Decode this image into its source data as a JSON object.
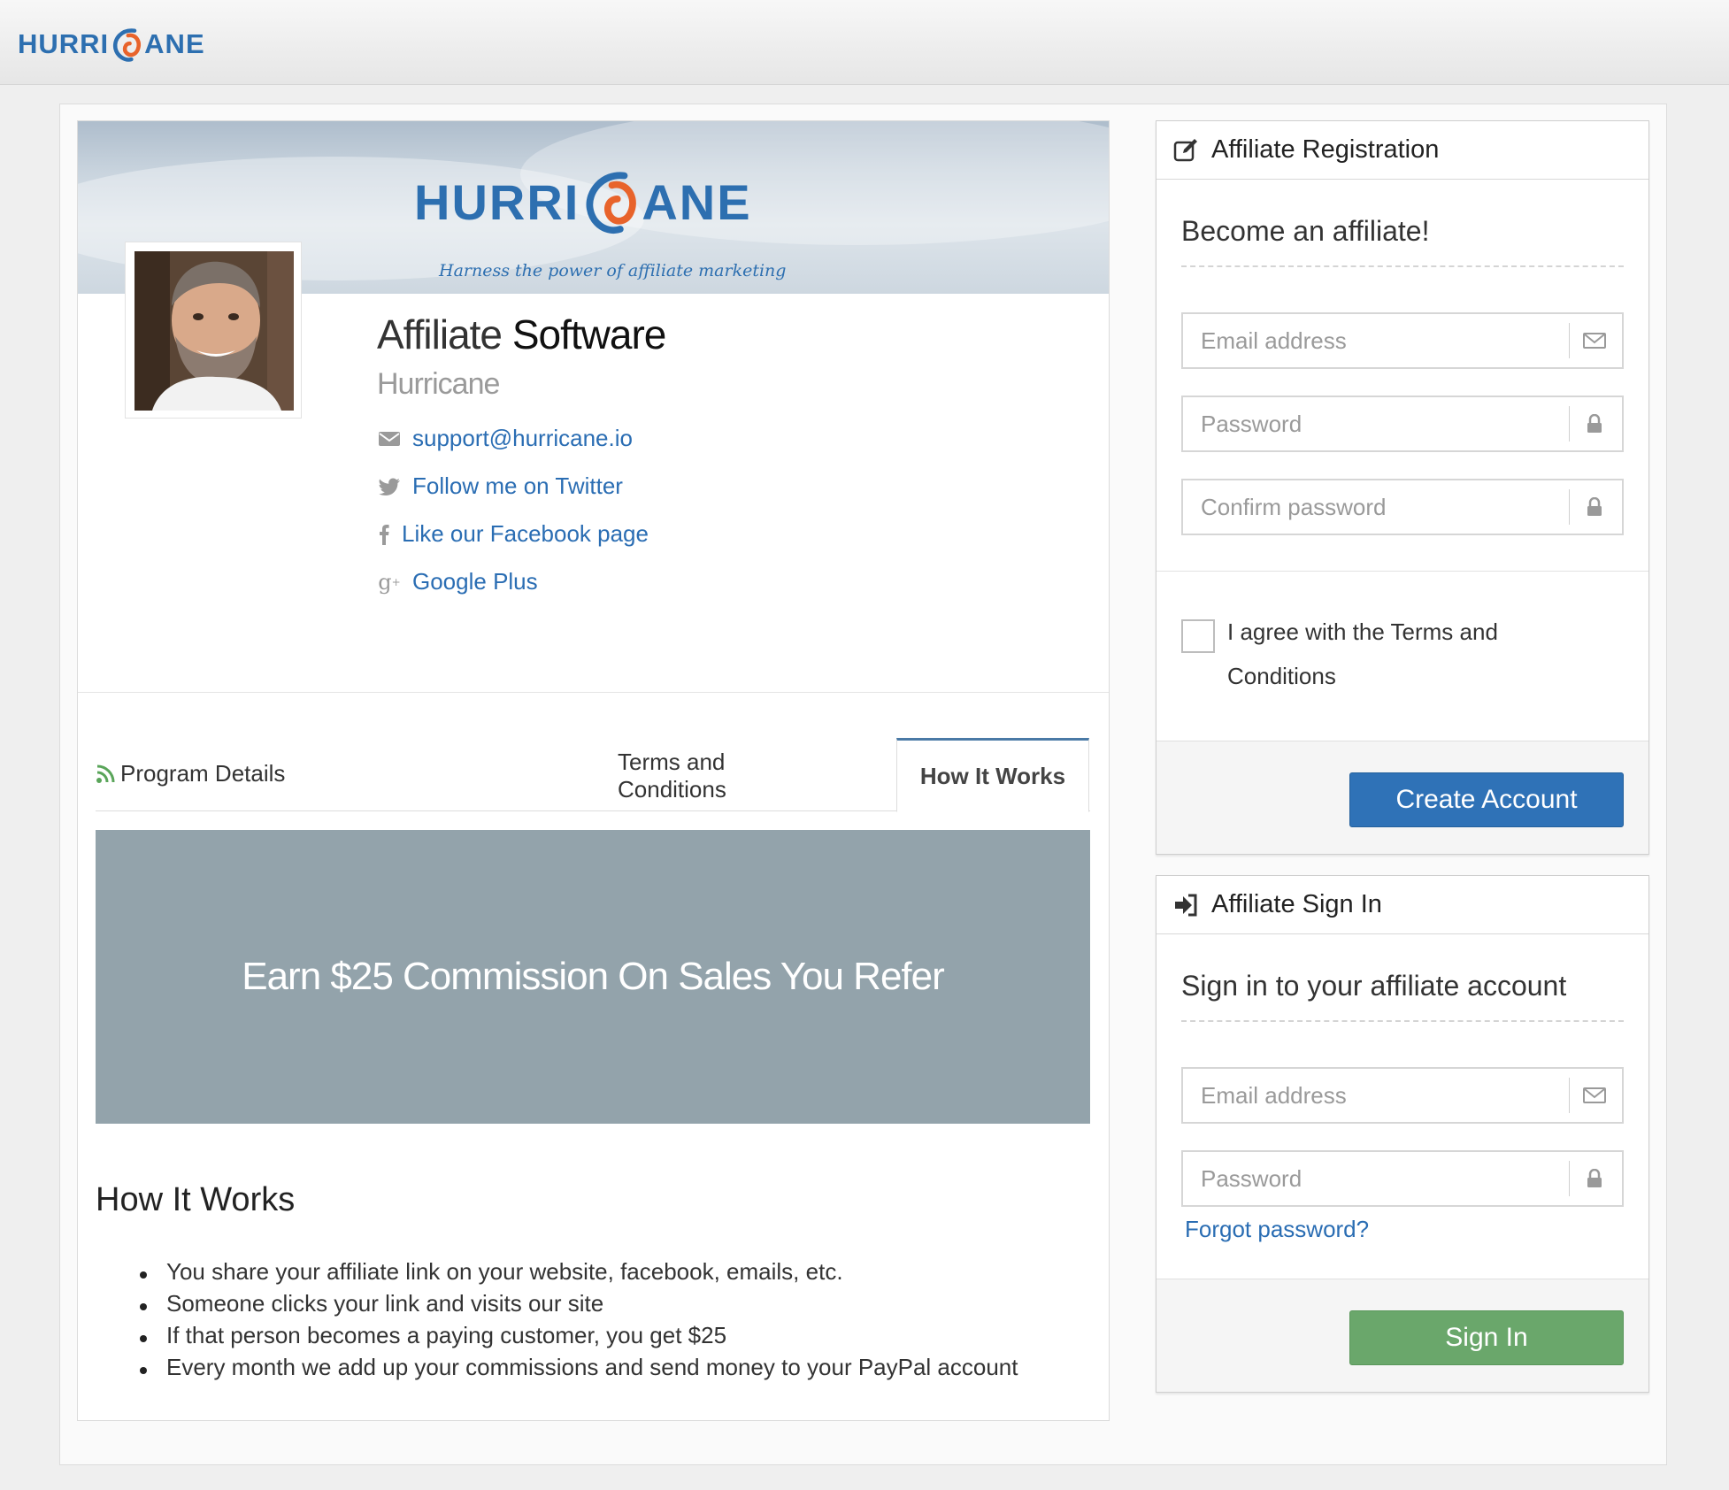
{
  "header": {
    "brand": "HURRICANE",
    "brand_left": "HURRI",
    "brand_right": "ANE"
  },
  "profile": {
    "banner_brand_left": "HURRI",
    "banner_brand_right": "ANE",
    "banner_tagline": "Harness the power of affiliate marketing",
    "title_light": "Affiliate",
    "title_bold": "Software",
    "subtitle": "Hurricane",
    "contacts": [
      {
        "icon": "envelope-icon",
        "label": "support@hurricane.io"
      },
      {
        "icon": "twitter-icon",
        "label": "Follow me on Twitter"
      },
      {
        "icon": "facebook-icon",
        "label": "Like our Facebook page"
      },
      {
        "icon": "google-plus-icon",
        "label": "Google Plus"
      }
    ]
  },
  "tabs": {
    "left_label": "Program Details",
    "items": [
      {
        "label": "Terms and Conditions",
        "active": false
      },
      {
        "label": "How It Works",
        "active": true
      }
    ]
  },
  "how_it_works": {
    "hero_text": "Earn $25 Commission On Sales You Refer",
    "title": "How It Works",
    "bullets": [
      "You share your affiliate link on your website, facebook, emails, etc.",
      "Someone clicks your link and visits our site",
      "If that person becomes a paying customer, you get $25",
      "Every month we add up your commissions and send money to your PayPal account"
    ]
  },
  "registration": {
    "heading": "Affiliate Registration",
    "intro": "Become an affiliate!",
    "email_placeholder": "Email address",
    "password_placeholder": "Password",
    "confirm_placeholder": "Confirm password",
    "agree_label": "I agree with the Terms and Conditions",
    "submit_label": "Create Account"
  },
  "signin": {
    "heading": "Affiliate Sign In",
    "intro": "Sign in to your affiliate account",
    "email_placeholder": "Email address",
    "password_placeholder": "Password",
    "forgot_label": "Forgot password?",
    "submit_label": "Sign In"
  },
  "colors": {
    "brand_blue": "#2d6fb0",
    "brand_orange": "#e8632b",
    "link_blue": "#2a6db3",
    "primary_button": "#2f72b7",
    "success_button": "#6aa76b",
    "hero_bg": "#93a3ab",
    "active_tab_border": "#4a7aa6"
  }
}
